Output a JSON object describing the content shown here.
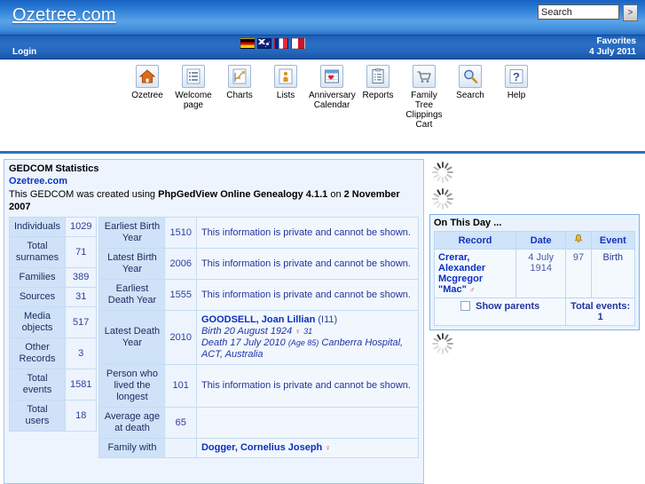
{
  "header": {
    "site_title": "Ozetree.com",
    "search_value": "Search",
    "search_placeholder": "Search",
    "search_go_label": ">",
    "login_label": "Login",
    "favorites_label": "Favorites",
    "date_label": "4 July 2011",
    "flags": [
      {
        "name": "flag-germany",
        "code": "de"
      },
      {
        "name": "flag-australia",
        "code": "au"
      },
      {
        "name": "flag-france",
        "code": "fr"
      },
      {
        "name": "flag-malta",
        "code": "mt"
      }
    ]
  },
  "toolbar": {
    "items": [
      {
        "label": "Ozetree",
        "icon": "home-icon"
      },
      {
        "label": "Welcome page",
        "icon": "list-lines-icon"
      },
      {
        "label": "Charts",
        "icon": "chart-icon"
      },
      {
        "label": "Lists",
        "icon": "person-icon"
      },
      {
        "label": "Anniversary Calendar",
        "icon": "calendar-heart-icon"
      },
      {
        "label": "Reports",
        "icon": "clipboard-icon"
      },
      {
        "label": "Family Tree Clippings Cart",
        "icon": "cart-icon"
      },
      {
        "label": "Search",
        "icon": "magnifier-icon"
      },
      {
        "label": "Help",
        "icon": "question-icon"
      }
    ]
  },
  "statistics": {
    "panel_title": "GEDCOM Statistics",
    "gedcom_link": "Ozetree.com",
    "desc_prefix": "This GEDCOM was created using ",
    "desc_program": "PhpGedView Online Genealogy 4.1.1",
    "desc_middle": " on ",
    "desc_date": "2 November 2007",
    "left_rows": [
      {
        "label": "Individuals",
        "value": "1029"
      },
      {
        "label": "Total surnames",
        "value": "71"
      },
      {
        "label": "Families",
        "value": "389"
      },
      {
        "label": "Sources",
        "value": "31"
      },
      {
        "label": "Media objects",
        "value": "517"
      },
      {
        "label": "Other Records",
        "value": "3"
      },
      {
        "label": "Total events",
        "value": "1581"
      },
      {
        "label": "Total users",
        "value": "18"
      }
    ],
    "private_note": "This information is private and cannot be shown.",
    "right_rows": [
      {
        "label": "Earliest Birth Year",
        "value": "1510",
        "note": "This information is private and cannot be shown."
      },
      {
        "label": "Latest Birth Year",
        "value": "2006",
        "note": "This information is private and cannot be shown."
      },
      {
        "label": "Earliest Death Year",
        "value": "1555",
        "note": "This information is private and cannot be shown."
      },
      {
        "label": "Latest Death Year",
        "value": "2010",
        "note": ""
      },
      {
        "label": "Person who lived the longest",
        "value": "101",
        "note": "This information is private and cannot be shown."
      },
      {
        "label": "Average age at death",
        "value": "65",
        "note": ""
      },
      {
        "label": "Family with",
        "value": "",
        "note": ""
      }
    ],
    "latest_death_person": {
      "name": "GOODSELL, Joan Lillian",
      "id": "(I11)",
      "birth_line": "Birth 20 August 1924",
      "birth_age": "31",
      "death_line": "Death 17 July 2010",
      "death_age": "(Age 85)",
      "death_place": "Canberra Hospital, ACT, Australia",
      "sex_symbol": "♀"
    },
    "family_with_person": {
      "name": "Dogger, Cornelius Joseph",
      "sex_symbol": "♀"
    }
  },
  "sidebar": {
    "on_this_day": {
      "title": "On This Day ...",
      "columns": [
        "Record",
        "Date",
        "bell-icon",
        "Event"
      ],
      "bell_glyph": "🔔",
      "rows": [
        {
          "record_line1": "Crerar, Alexander",
          "record_line2": "Mcgregor \"Mac\"",
          "sex_symbol": "♂",
          "date": "4 July 1914",
          "age": "97",
          "event": "Birth"
        }
      ],
      "show_parents_label": "Show parents",
      "show_parents_checked": false,
      "total_events_label": "Total events: 1"
    }
  },
  "colors": {
    "brand_blue": "#2f7fd8",
    "panel_border": "#a8c6e5",
    "header_cell": "#cfe2f8",
    "link_blue": "#0a2fc0"
  }
}
